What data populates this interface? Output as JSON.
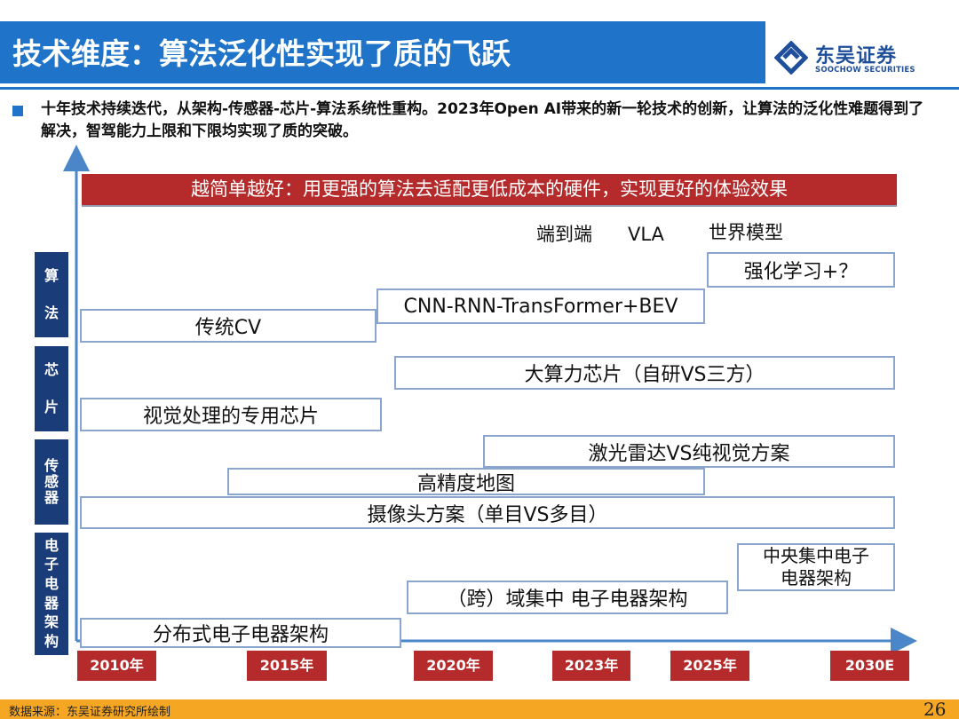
{
  "header": {
    "title": "技术维度：算法泛化性实现了质的飞跃"
  },
  "logo": {
    "cn": "东吴证券",
    "en": "SOOCHOW SECURITIES"
  },
  "summary": "十年技术持续迭代，从架构-传感器-芯片-算法系统性重构。2023年Open AI带来的新一轮技术的创新，让算法的泛化性难题得到了解决，智驾能力上限和下限均实现了质的突破。",
  "banner": "越简单越好：用更强的算法去适配更低成本的硬件，实现更好的体验效果",
  "categories": {
    "algorithm": [
      "算",
      "法"
    ],
    "chip": [
      "芯",
      "片"
    ],
    "sensor": [
      "传",
      "感",
      "器"
    ],
    "architecture": [
      "电",
      "子",
      "电",
      "器",
      "架",
      "构"
    ]
  },
  "labels": {
    "e2e": "端到端",
    "vla": "VLA",
    "world_model": "世界模型"
  },
  "tech": {
    "rl": "强化学习+？",
    "cnn": "CNN-RNN-TransFormer+BEV",
    "cv": "传统CV",
    "big_chip": "大算力芯片（自研VS三方）",
    "vision_chip": "视觉处理的专用芯片",
    "lidar": "激光雷达VS纯视觉方案",
    "hd_map": "高精度地图",
    "camera": "摄像头方案（单目VS多目）",
    "central_1": "中央集中电子",
    "central_2": "电器架构",
    "domain": "（跨）域集中 电子电器架构",
    "distributed": "分布式电子电器架构"
  },
  "years": [
    "2010年",
    "2015年",
    "2020年",
    "2023年",
    "2025年",
    "2030E"
  ],
  "footer": {
    "source": "数据来源：东吴证券研究所绘制",
    "page": "26"
  },
  "colors": {
    "primary_blue": "#1f74c9",
    "navy": "#1a3c78",
    "red": "#b52b2b",
    "box_border": "#8aa6cf",
    "footer_orange": "#f5a623"
  }
}
